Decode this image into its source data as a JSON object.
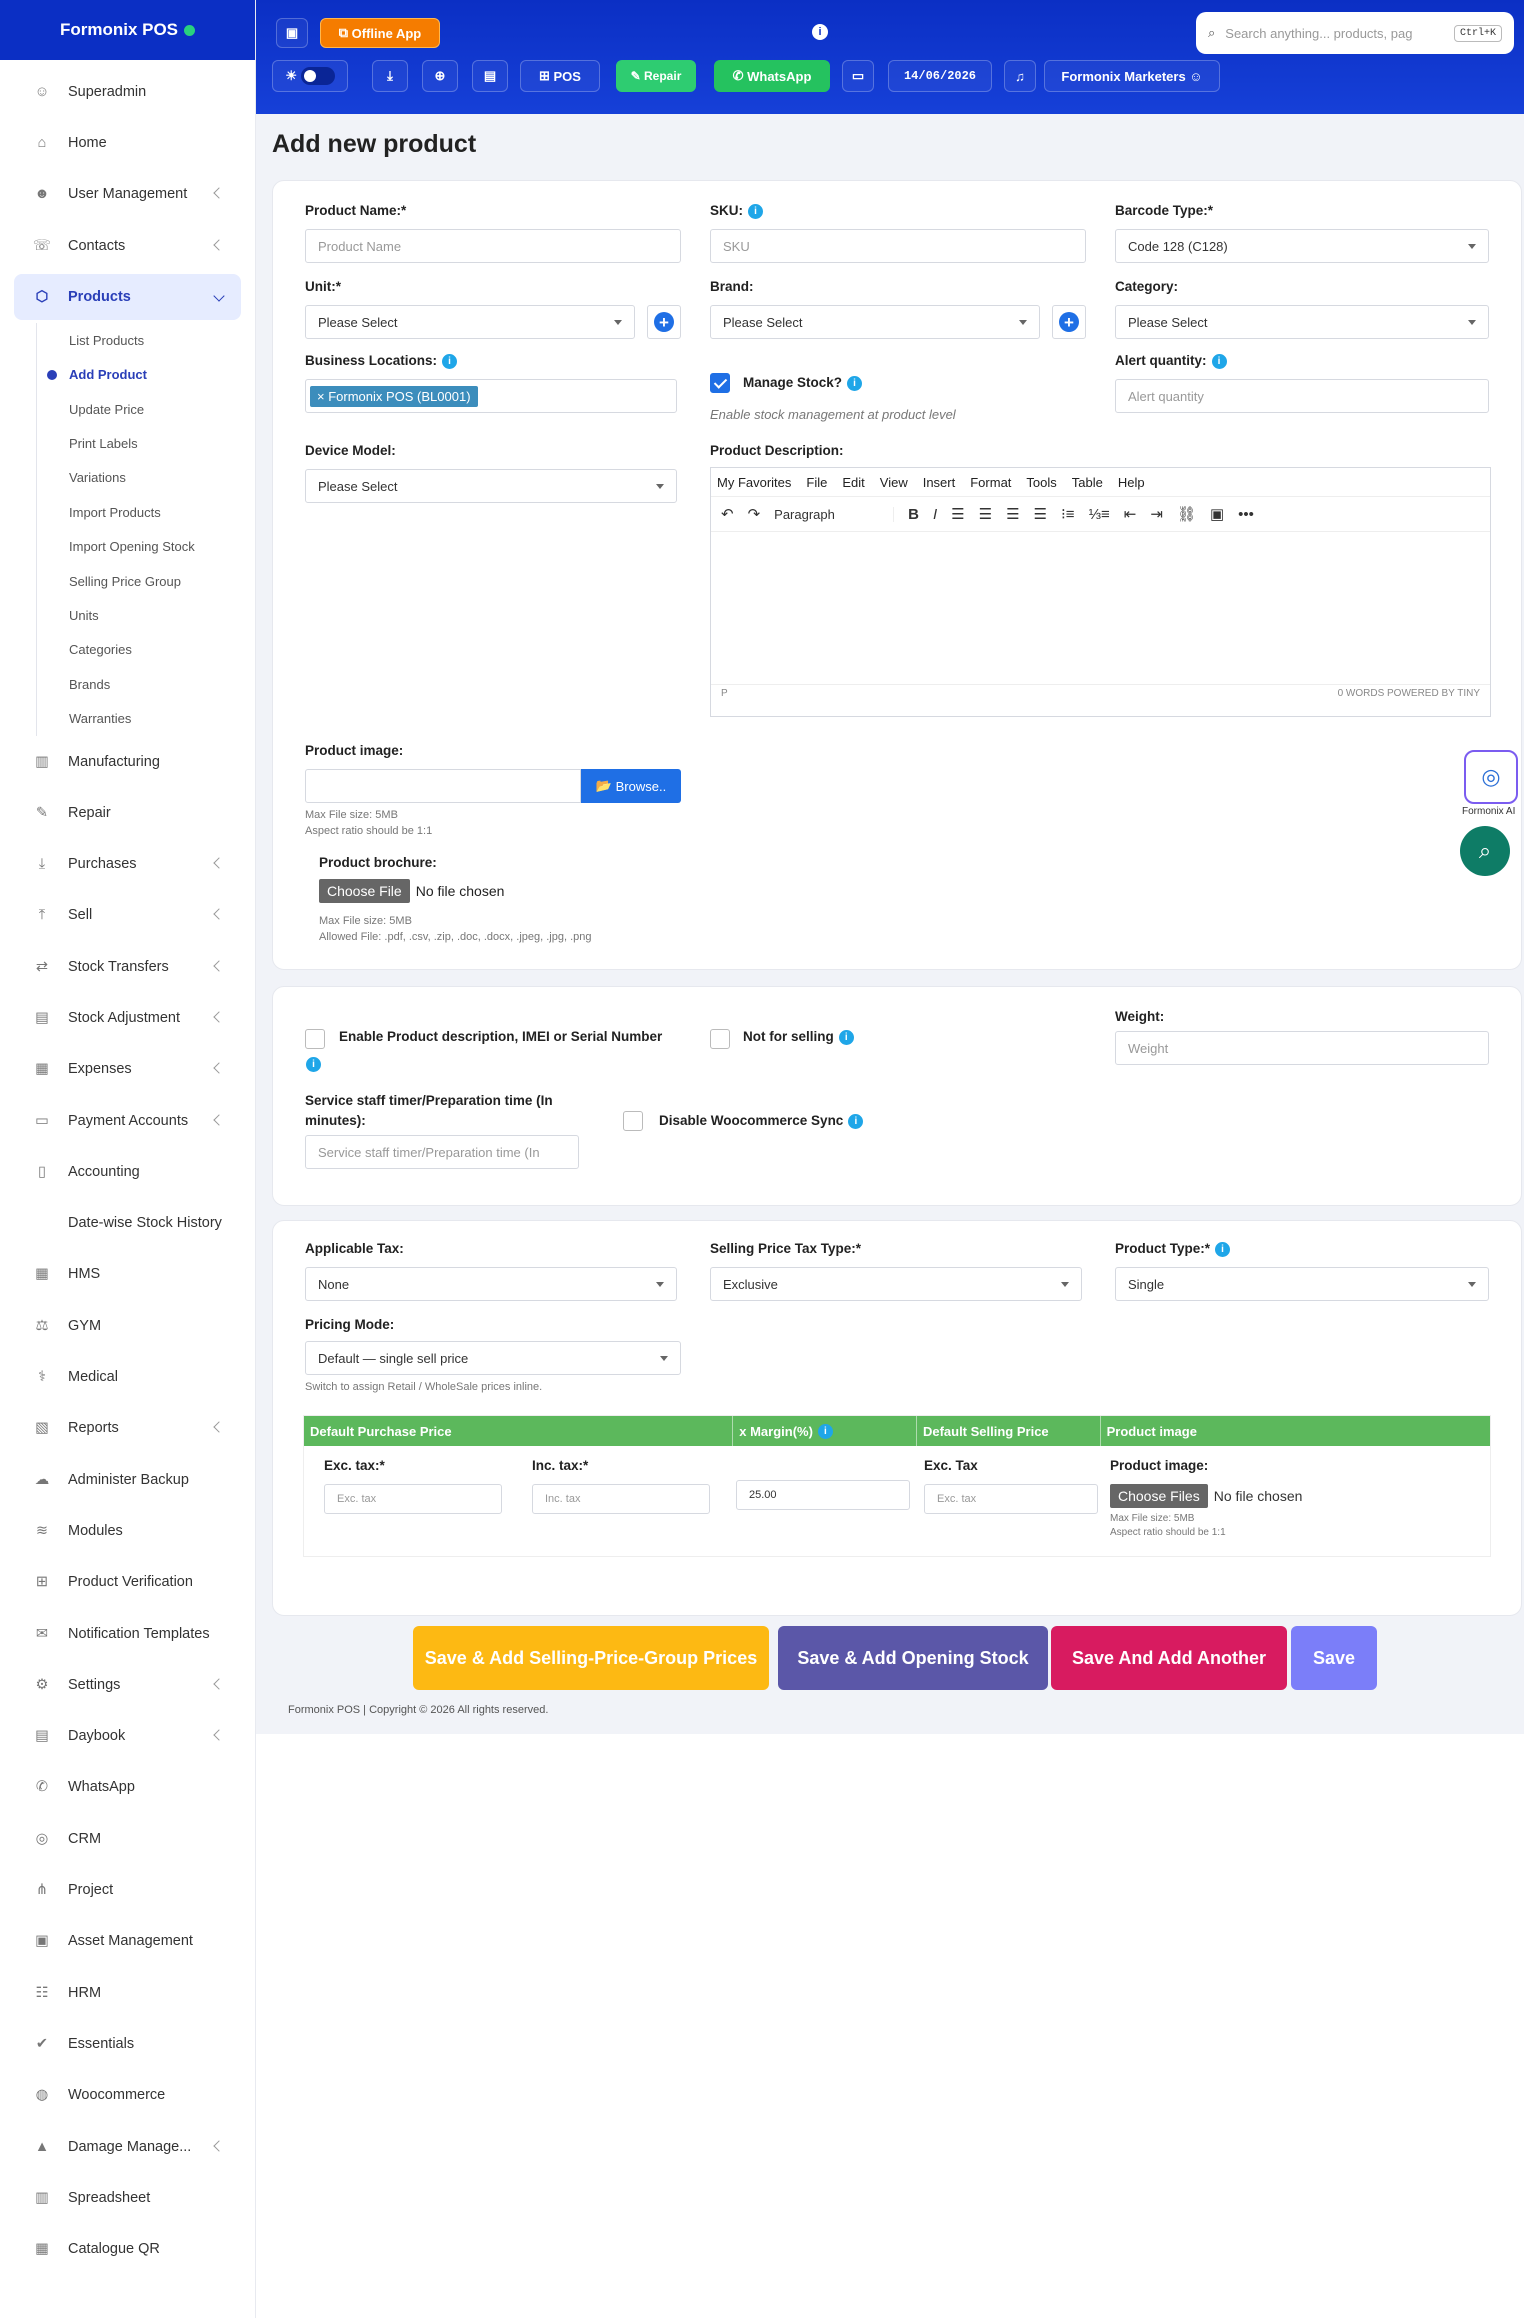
{
  "brand": {
    "name": "Formonix POS"
  },
  "sidebar": {
    "items": [
      "Superadmin",
      "Home",
      "User Management",
      "Contacts",
      "Products",
      "Manufacturing",
      "Repair",
      "Purchases",
      "Sell",
      "Stock Transfers",
      "Stock Adjustment",
      "Expenses",
      "Payment Accounts",
      "Accounting",
      "Date-wise Stock History",
      "HMS",
      "GYM",
      "Medical",
      "Reports",
      "Administer Backup",
      "Modules",
      "Product Verification",
      "Notification Templates",
      "Settings",
      "Daybook",
      "WhatsApp",
      "CRM",
      "Project",
      "Asset Management",
      "HRM",
      "Essentials",
      "Woocommerce",
      "Damage Manage...",
      "Spreadsheet",
      "Catalogue QR"
    ],
    "sub": [
      "List Products",
      "Add Product",
      "Update Price",
      "Print Labels",
      "Variations",
      "Import Products",
      "Import Opening Stock",
      "Selling Price Group",
      "Units",
      "Categories",
      "Brands",
      "Warranties"
    ]
  },
  "topbar": {
    "offline": "Offline App",
    "pos": "POS",
    "repair": "Repair",
    "whatsapp": "WhatsApp",
    "date": "14/06/2026",
    "business": "Formonix Marketers",
    "search_placeholder": "Search anything... products, pag",
    "kbd": "Ctrl+K"
  },
  "page": {
    "title": "Add new product"
  },
  "form": {
    "product_name": "Product Name:*",
    "product_name_ph": "Product Name",
    "sku": "SKU:",
    "sku_ph": "SKU",
    "barcode": "Barcode Type:*",
    "barcode_val": "Code 128 (C128)",
    "unit": "Unit:*",
    "unit_val": "Please Select",
    "brand": "Brand:",
    "brand_val": "Please Select",
    "category": "Category:",
    "category_val": "Please Select",
    "locations": "Business Locations:",
    "location_tag": "× Formonix POS (BL0001)",
    "manage_stock": "Manage Stock?",
    "manage_hint": "Enable stock management at product level",
    "alert": "Alert quantity:",
    "alert_ph": "Alert quantity",
    "device": "Device Model:",
    "device_val": "Please Select",
    "desc": "Product Description:",
    "editor_menu": [
      "My Favorites",
      "File",
      "Edit",
      "View",
      "Insert",
      "Format",
      "Tools",
      "Table",
      "Help"
    ],
    "editor_block": "Paragraph",
    "editor_p": "P",
    "editor_status": "0 WORDS  POWERED BY TINY",
    "image": "Product image:",
    "browse": "Browse..",
    "image_hint1": "Max File size: 5MB",
    "image_hint2": "Aspect ratio should be 1:1",
    "brochure": "Product brochure:",
    "choose_file": "Choose File",
    "no_file": "No file chosen",
    "brochure_hint1": "Max File size: 5MB",
    "brochure_hint2": "Allowed File: .pdf, .csv, .zip, .doc, .docx, .jpeg, .jpg, .png",
    "enable_desc": "Enable Product description, IMEI or Serial Number",
    "not_selling": "Not for selling",
    "weight": "Weight:",
    "weight_ph": "Weight",
    "staff_timer": "Service staff timer/Preparation time (In minutes):",
    "staff_ph": "Service staff timer/Preparation time (In",
    "woo_sync": "Disable Woocommerce Sync",
    "tax": "Applicable Tax:",
    "tax_val": "None",
    "sp_tax": "Selling Price Tax Type:*",
    "sp_tax_val": "Exclusive",
    "ptype": "Product Type:*",
    "ptype_val": "Single",
    "pricing": "Pricing Mode:",
    "pricing_val": "Default — single sell price",
    "pricing_hint": "Switch to assign Retail / WholeSale prices inline.",
    "th": [
      "Default Purchase Price",
      "x Margin(%)",
      "Default Selling Price",
      "Product image"
    ],
    "exc": "Exc. tax:*",
    "inc": "Inc. tax:*",
    "exc_ph": "Exc. tax",
    "inc_ph": "Inc. tax",
    "margin": "25.00",
    "exc2": "Exc. Tax",
    "exc2_ph": "Exc. tax",
    "pimg": "Product image:",
    "choose_files": "Choose Files",
    "pimg_hint1": "Max File size: 5MB",
    "pimg_hint2": "Aspect ratio should be 1:1"
  },
  "actions": {
    "b1": "Save & Add Selling-Price-Group Prices",
    "b2": "Save & Add Opening Stock",
    "b3": "Save And Add Another",
    "b4": "Save"
  },
  "footer": "Formonix POS | Copyright © 2026 All rights reserved.",
  "ai": "Formonix AI",
  "colors": {
    "brand": "#0b2fc4",
    "green": "#5cb85c",
    "b1": "#fdb913",
    "b2": "#5b57a8",
    "b3": "#d81b60",
    "b4": "#7b7ef9"
  }
}
